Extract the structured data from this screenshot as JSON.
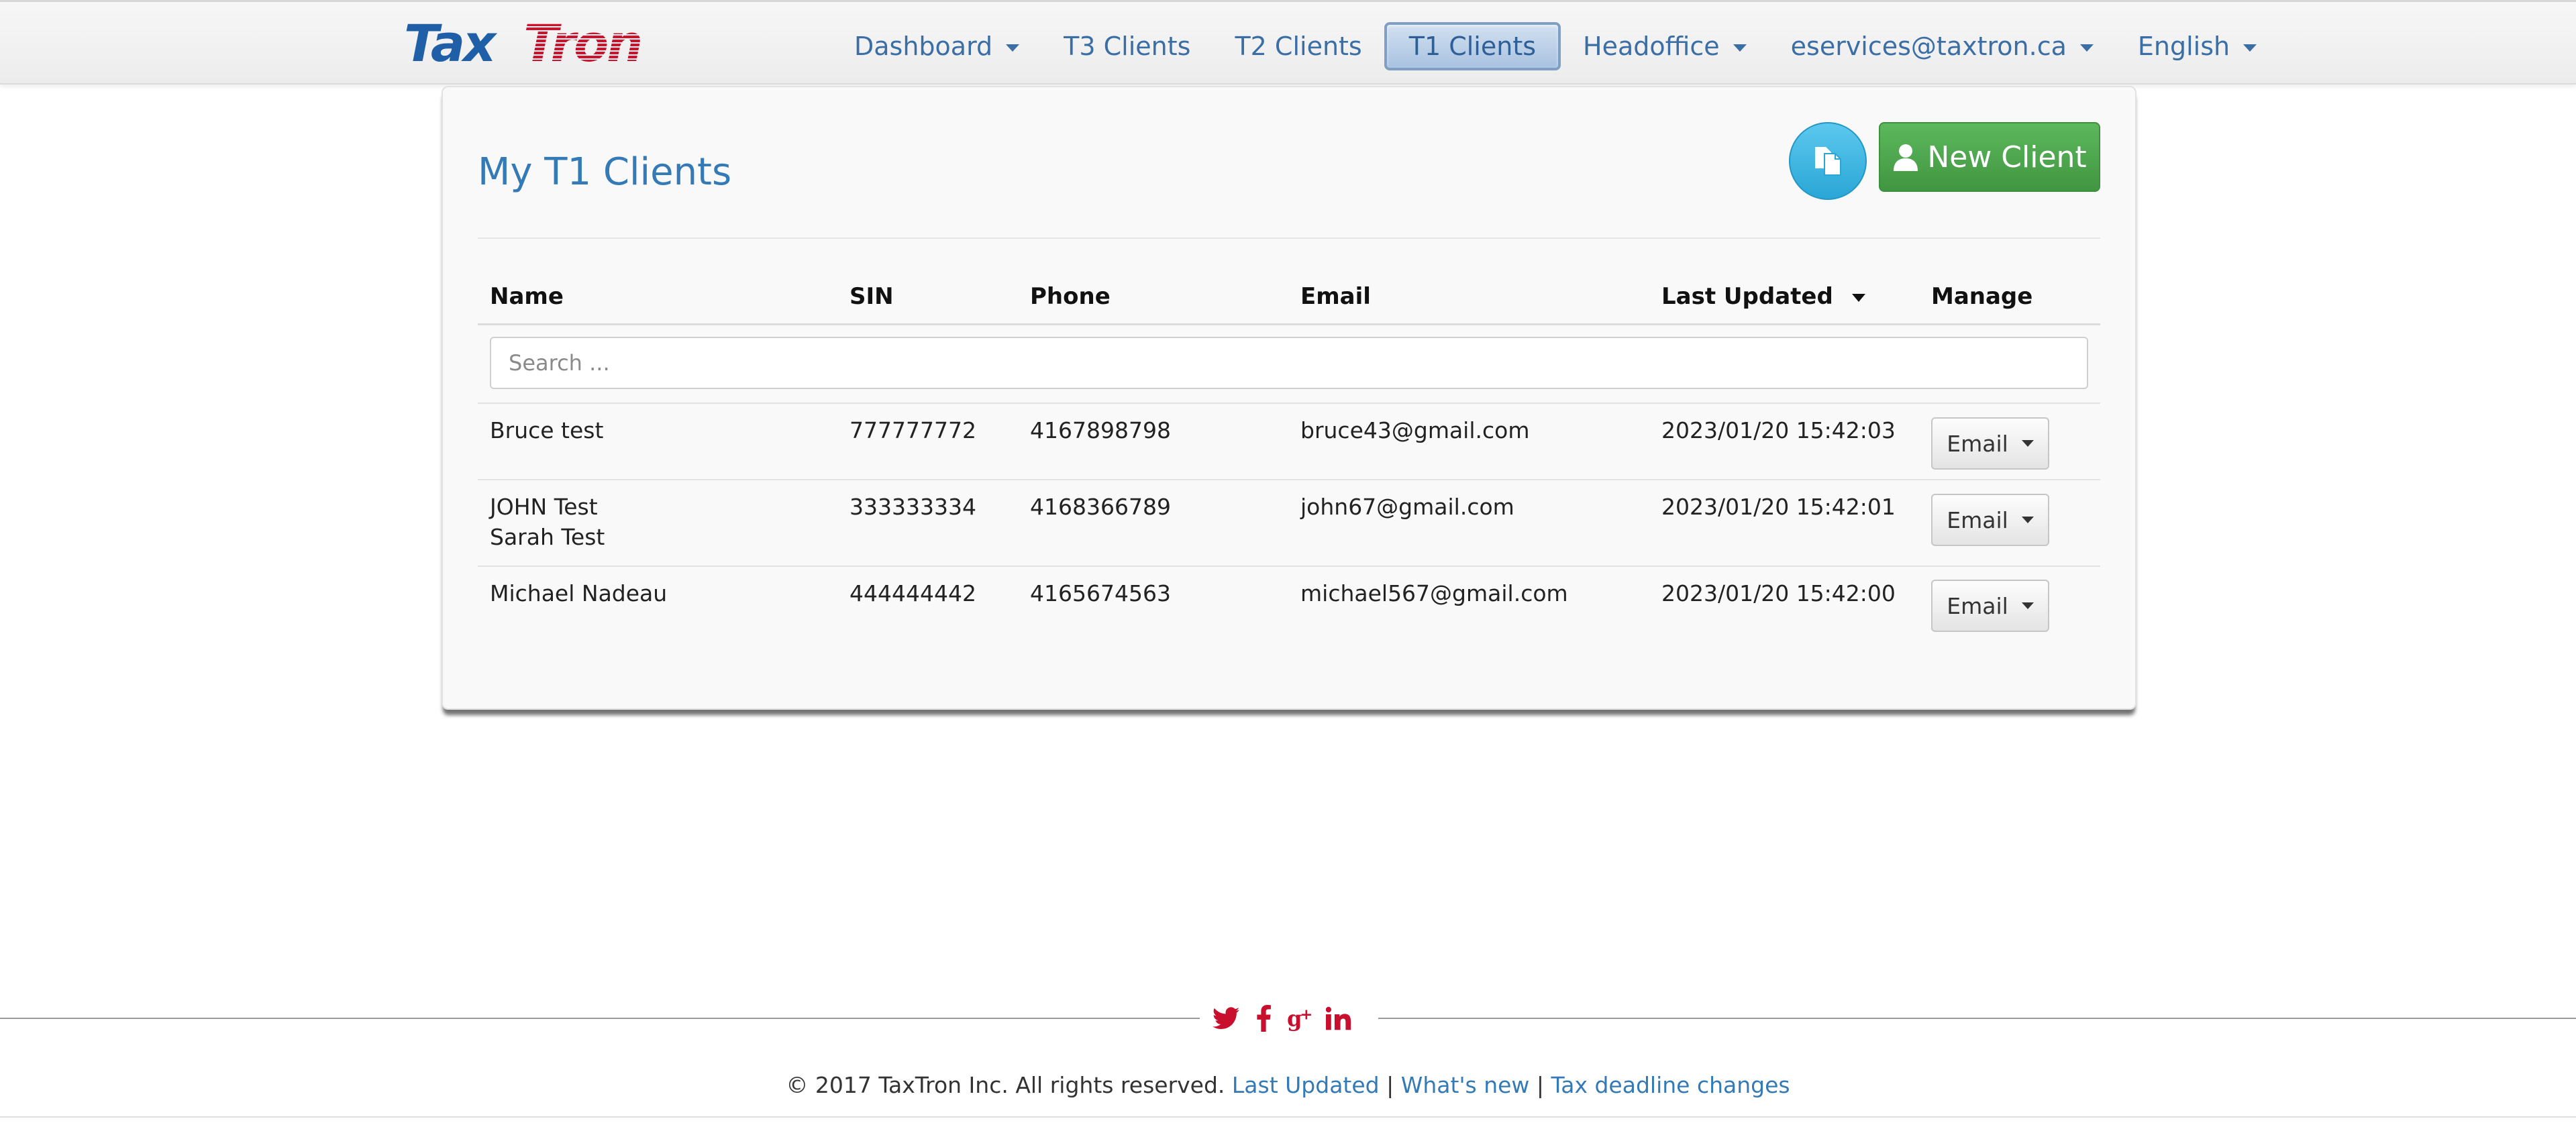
{
  "brand": {
    "logo_text": "TaxTron"
  },
  "nav": {
    "items": [
      {
        "label": "Dashboard",
        "has_caret": true
      },
      {
        "label": "T3 Clients",
        "has_caret": false
      },
      {
        "label": "T2 Clients",
        "has_caret": false
      },
      {
        "label": "T1 Clients",
        "has_caret": false,
        "active": true
      },
      {
        "label": "Headoffice",
        "has_caret": true
      },
      {
        "label": "eservices@taxtron.ca",
        "has_caret": true
      },
      {
        "label": "English",
        "has_caret": true
      }
    ]
  },
  "main": {
    "title": "My T1 Clients",
    "copy_icon": "copy-documents-icon",
    "new_client_label": "New Client",
    "table": {
      "columns": [
        "Name",
        "SIN",
        "Phone",
        "Email",
        "Last Updated",
        "Manage"
      ],
      "search_placeholder": "Search ...",
      "rows": [
        {
          "name": "Bruce test",
          "name2": "",
          "sin": "777777772",
          "phone": "4167898798",
          "email": "bruce43@gmail.com",
          "updated": "2023/01/20 15:42:03",
          "manage": "Email"
        },
        {
          "name": "JOHN Test",
          "name2": "Sarah Test",
          "sin": "333333334",
          "phone": "4168366789",
          "email": "john67@gmail.com",
          "updated": "2023/01/20 15:42:01",
          "manage": "Email"
        },
        {
          "name": "Michael Nadeau",
          "name2": "",
          "sin": "444444442",
          "phone": "4165674563",
          "email": "michael567@gmail.com",
          "updated": "2023/01/20 15:42:00",
          "manage": "Email"
        }
      ]
    }
  },
  "footer": {
    "social_icons": [
      "twitter-icon",
      "facebook-icon",
      "google-plus-icon",
      "linkedin-icon"
    ],
    "copyright": "© 2017 TaxTron Inc. All rights reserved.",
    "links": [
      "Last Updated",
      "What's new",
      "Tax deadline changes"
    ],
    "separator": "|"
  },
  "colors": {
    "brand_blue": "#1f5fa8",
    "brand_red": "#d0112b",
    "link": "#337ab7",
    "success": "#4cae4c",
    "info": "#31b0d5"
  }
}
